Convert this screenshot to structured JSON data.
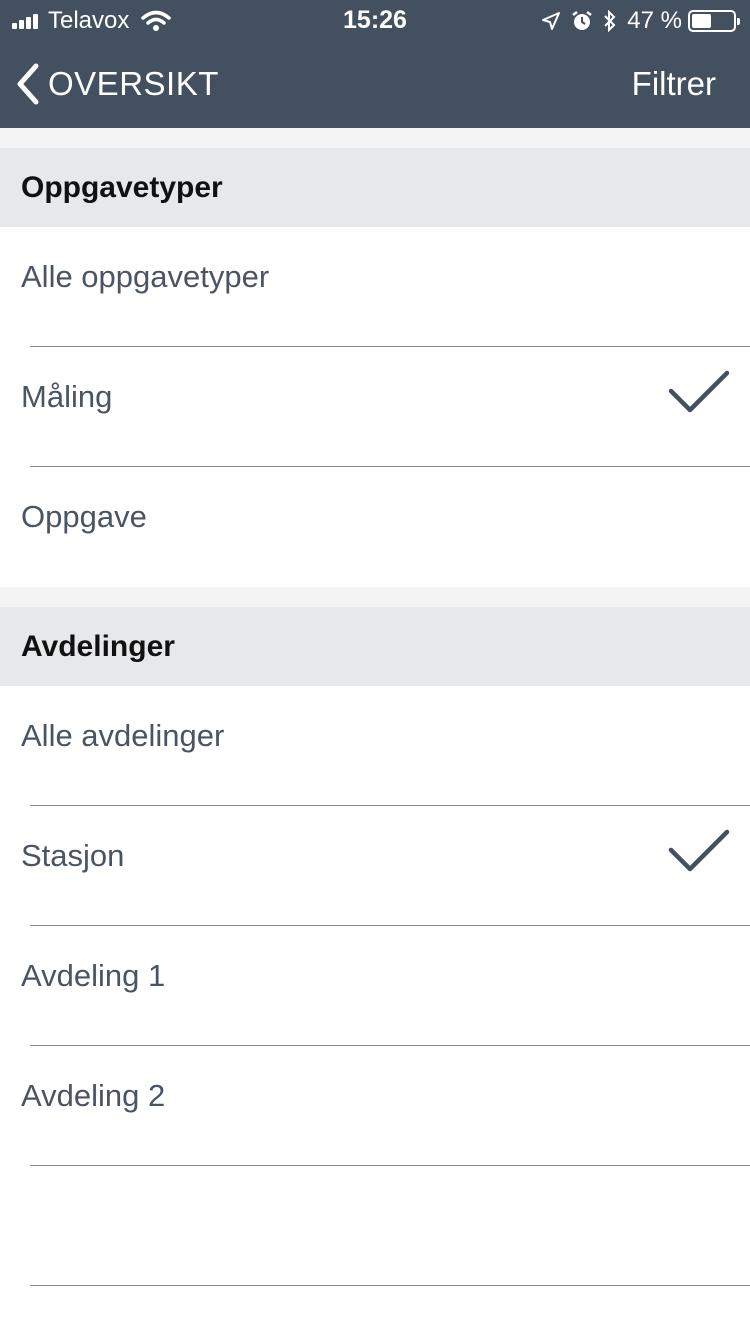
{
  "status_bar": {
    "carrier": "Telavox",
    "time": "15:26",
    "battery_text": "47 %",
    "battery_level": 0.47
  },
  "nav": {
    "back_label": "OVERSIKT",
    "right_label": "Filtrer"
  },
  "sections": [
    {
      "title": "Oppgavetyper",
      "items": [
        {
          "label": "Alle oppgavetyper",
          "checked": false
        },
        {
          "label": "Måling",
          "checked": true
        },
        {
          "label": "Oppgave",
          "checked": false
        }
      ]
    },
    {
      "title": "Avdelinger",
      "items": [
        {
          "label": "Alle avdelinger",
          "checked": false
        },
        {
          "label": "Stasjon",
          "checked": true
        },
        {
          "label": "Avdeling 1",
          "checked": false
        },
        {
          "label": "Avdeling 2",
          "checked": false
        },
        {
          "label": "",
          "checked": false
        }
      ]
    }
  ],
  "colors": {
    "header": "#435060",
    "section_header": "#e6e8ea",
    "row_text": "#4a5563",
    "checkmark": "#435060"
  }
}
